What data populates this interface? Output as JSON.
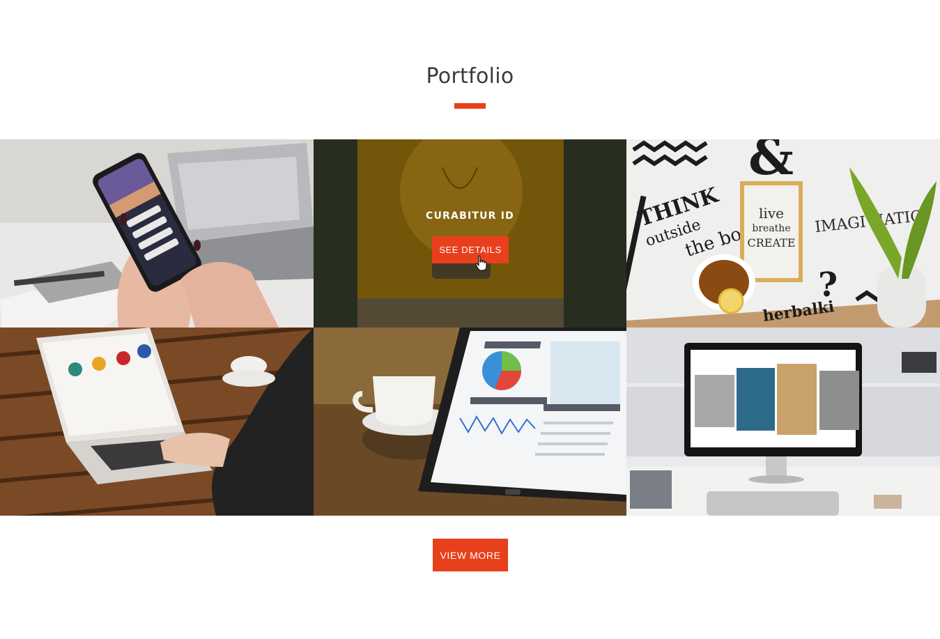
{
  "section": {
    "title": "Portfolio"
  },
  "portfolio": {
    "items": [
      {
        "icon": "phone-in-hands-photo"
      },
      {
        "icon": "lightbulb-photo",
        "hover_title": "CURABITUR ID",
        "hover_button": "SEE DETAILS"
      },
      {
        "icon": "typography-prints-photo"
      },
      {
        "icon": "laptop-on-table-photo"
      },
      {
        "icon": "tablet-analytics-photo"
      },
      {
        "icon": "desktop-monitor-photo"
      }
    ]
  },
  "actions": {
    "view_more_label": "VIEW MORE"
  },
  "colors": {
    "accent": "#e8401c",
    "title": "#3a3a3a",
    "background": "#ffffff"
  }
}
